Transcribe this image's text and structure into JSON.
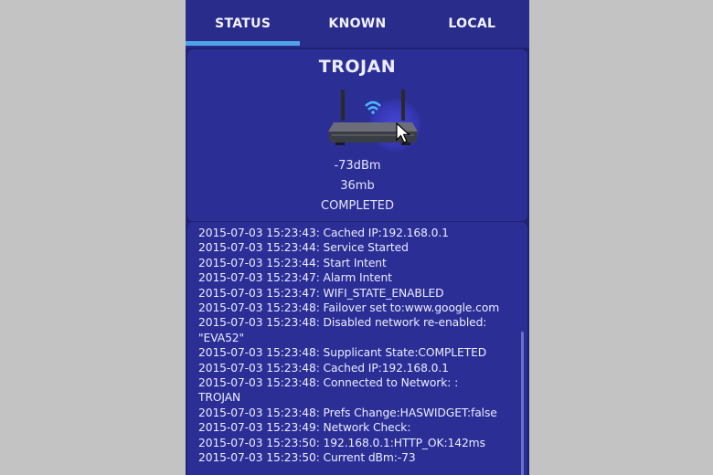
{
  "tabs": [
    {
      "label": "STATUS",
      "active": true
    },
    {
      "label": "KNOWN",
      "active": false
    },
    {
      "label": "LOCAL",
      "active": false
    }
  ],
  "status": {
    "ssid": "TROJAN",
    "signal": "-73dBm",
    "speed": "36mb",
    "state": "COMPLETED",
    "icon": "wifi-router-icon"
  },
  "log": [
    "2015-07-03 15:23:43: Cached IP:192.168.0.1",
    "2015-07-03 15:23:44: Service Started",
    "2015-07-03 15:23:44: Start Intent",
    "2015-07-03 15:23:47: Alarm Intent",
    "2015-07-03 15:23:47: WIFI_STATE_ENABLED",
    "2015-07-03 15:23:48: Failover set to:www.google.com",
    "2015-07-03 15:23:48: Disabled network re-enabled:",
    "\"EVA52\"",
    "2015-07-03 15:23:48: Supplicant State:COMPLETED",
    "2015-07-03 15:23:48: Cached IP:192.168.0.1",
    "2015-07-03 15:23:48: Connected to Network: :",
    "TROJAN",
    "2015-07-03 15:23:48: Prefs Change:HASWIDGET:false",
    "2015-07-03 15:23:49: Network Check:",
    "2015-07-03 15:23:50: 192.168.0.1:HTTP_OK:142ms",
    "2015-07-03 15:23:50: Current dBm:-73"
  ],
  "colors": {
    "background": "#20226e",
    "card": "#2b2e95",
    "tab_indicator": "#4fa3e8",
    "side_bars": "#c3c3c3"
  }
}
